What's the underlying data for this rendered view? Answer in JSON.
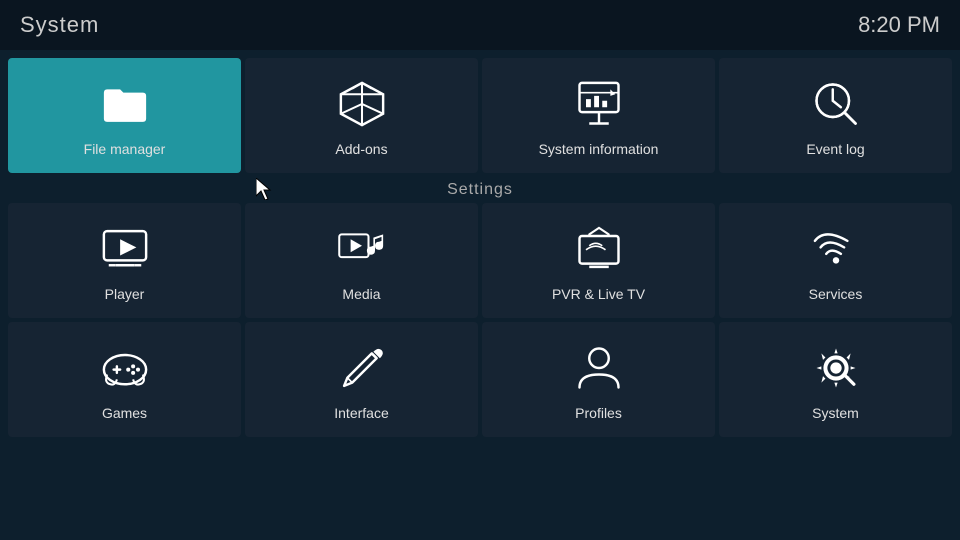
{
  "header": {
    "title": "System",
    "time": "8:20 PM"
  },
  "top_tiles": [
    {
      "id": "file-manager",
      "label": "File manager",
      "active": true
    },
    {
      "id": "add-ons",
      "label": "Add-ons",
      "active": false
    },
    {
      "id": "system-information",
      "label": "System information",
      "active": false
    },
    {
      "id": "event-log",
      "label": "Event log",
      "active": false
    }
  ],
  "settings_label": "Settings",
  "settings_row1": [
    {
      "id": "player",
      "label": "Player"
    },
    {
      "id": "media",
      "label": "Media"
    },
    {
      "id": "pvr-live-tv",
      "label": "PVR & Live TV"
    },
    {
      "id": "services",
      "label": "Services"
    }
  ],
  "settings_row2": [
    {
      "id": "games",
      "label": "Games"
    },
    {
      "id": "interface",
      "label": "Interface"
    },
    {
      "id": "profiles",
      "label": "Profiles"
    },
    {
      "id": "system",
      "label": "System"
    }
  ]
}
